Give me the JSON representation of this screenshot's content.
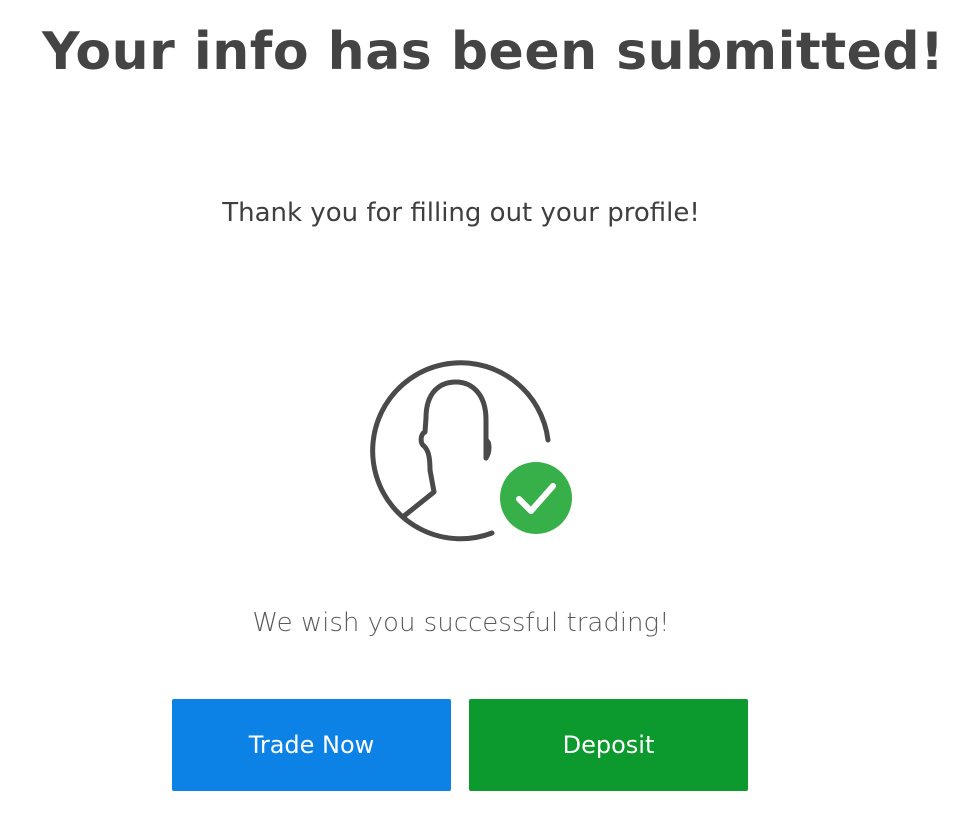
{
  "page": {
    "heading": "Your info has been submitted!",
    "subheading": "Thank you for filling out your profile!",
    "wish_text": "We wish you successful trading!"
  },
  "icons": {
    "avatar": "user-profile-icon",
    "check": "check-badge-icon"
  },
  "buttons": {
    "trade_label": "Trade Now",
    "deposit_label": "Deposit"
  },
  "colors": {
    "heading_text": "#444444",
    "icon_outline": "#4a4a4a",
    "check_badge": "#37b04a",
    "trade_button": "#0c82e6",
    "deposit_button": "#0c9a2e"
  }
}
